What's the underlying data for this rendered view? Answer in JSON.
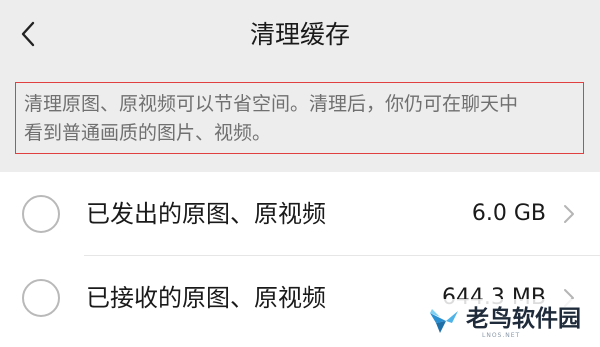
{
  "header": {
    "title": "清理缓存",
    "back_icon": "chevron-left-icon"
  },
  "notice": {
    "line1": "清理原图、原视频可以节省空间。清理后，你仍可在聊天中",
    "line2": "看到普通画质的图片、视频。",
    "border_color": "#e0403f"
  },
  "items": [
    {
      "label": "已发出的原图、原视频",
      "size": "6.0 GB",
      "checked": false
    },
    {
      "label": "已接收的原图、原视频",
      "size": "644.3 MB",
      "checked": false
    }
  ],
  "watermark": {
    "name": "老鸟软件园",
    "domain": "LNOS.NET"
  }
}
